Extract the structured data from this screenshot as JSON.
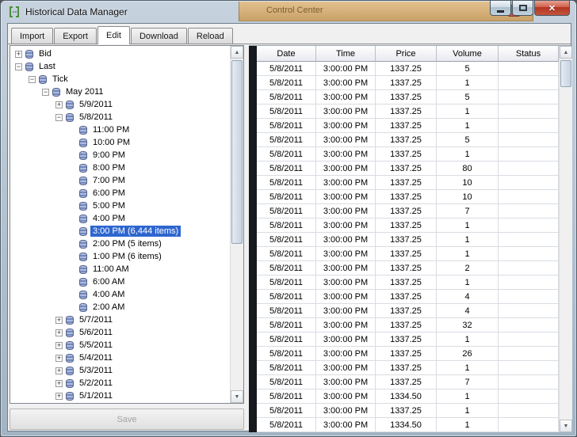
{
  "window": {
    "title": "Historical Data Manager"
  },
  "background_window": {
    "visible_text": "Control Center"
  },
  "icons": {
    "app": "bracket-icon",
    "minimize": "–",
    "maximize": "▢",
    "close": "✕",
    "scroll_up": "▲",
    "scroll_down": "▼",
    "tree_expand": "+",
    "tree_collapse": "−",
    "tree_node": "database-icon"
  },
  "colors": {
    "selection": "#2e66cf",
    "close_button": "#b23520",
    "background_window": "#d7a565",
    "client_background": "#f0f0f0",
    "row_header_strip": "#161a1f"
  },
  "tabs": [
    {
      "label": "Import",
      "active": false
    },
    {
      "label": "Export",
      "active": false
    },
    {
      "label": "Edit",
      "active": true
    },
    {
      "label": "Download",
      "active": false
    },
    {
      "label": "Reload",
      "active": false
    }
  ],
  "tree": {
    "items": [
      {
        "label": "Bid",
        "level": 0,
        "expand": "+"
      },
      {
        "label": "Last",
        "level": 0,
        "expand": "−"
      },
      {
        "label": "Tick",
        "level": 1,
        "expand": "−"
      },
      {
        "label": "May 2011",
        "level": 2,
        "expand": "−"
      },
      {
        "label": "5/9/2011",
        "level": 3,
        "expand": "+"
      },
      {
        "label": "5/8/2011",
        "level": 3,
        "expand": "−"
      },
      {
        "label": "11:00 PM",
        "level": 4
      },
      {
        "label": "10:00 PM",
        "level": 4
      },
      {
        "label": "9:00 PM",
        "level": 4
      },
      {
        "label": "8:00 PM",
        "level": 4
      },
      {
        "label": "7:00 PM",
        "level": 4
      },
      {
        "label": "6:00 PM",
        "level": 4
      },
      {
        "label": "5:00 PM",
        "level": 4
      },
      {
        "label": "4:00 PM",
        "level": 4
      },
      {
        "label": "3:00 PM (6,444 items)",
        "level": 4,
        "selected": true
      },
      {
        "label": "2:00 PM (5 items)",
        "level": 4
      },
      {
        "label": "1:00 PM (6 items)",
        "level": 4
      },
      {
        "label": "11:00 AM",
        "level": 4
      },
      {
        "label": "6:00 AM",
        "level": 4
      },
      {
        "label": "4:00 AM",
        "level": 4
      },
      {
        "label": "2:00 AM",
        "level": 4
      },
      {
        "label": "5/7/2011",
        "level": 3,
        "expand": "+"
      },
      {
        "label": "5/6/2011",
        "level": 3,
        "expand": "+"
      },
      {
        "label": "5/5/2011",
        "level": 3,
        "expand": "+"
      },
      {
        "label": "5/4/2011",
        "level": 3,
        "expand": "+"
      },
      {
        "label": "5/3/2011",
        "level": 3,
        "expand": "+"
      },
      {
        "label": "5/2/2011",
        "level": 3,
        "expand": "+"
      },
      {
        "label": "5/1/2011",
        "level": 3,
        "expand": "+"
      }
    ]
  },
  "buttons": {
    "save": {
      "label": "Save",
      "enabled": false
    }
  },
  "grid": {
    "columns": [
      "Date",
      "Time",
      "Price",
      "Volume",
      "Status"
    ],
    "rows": [
      [
        "5/8/2011",
        "3:00:00 PM",
        "1337.25",
        "5",
        ""
      ],
      [
        "5/8/2011",
        "3:00:00 PM",
        "1337.25",
        "1",
        ""
      ],
      [
        "5/8/2011",
        "3:00:00 PM",
        "1337.25",
        "5",
        ""
      ],
      [
        "5/8/2011",
        "3:00:00 PM",
        "1337.25",
        "1",
        ""
      ],
      [
        "5/8/2011",
        "3:00:00 PM",
        "1337.25",
        "1",
        ""
      ],
      [
        "5/8/2011",
        "3:00:00 PM",
        "1337.25",
        "5",
        ""
      ],
      [
        "5/8/2011",
        "3:00:00 PM",
        "1337.25",
        "1",
        ""
      ],
      [
        "5/8/2011",
        "3:00:00 PM",
        "1337.25",
        "80",
        ""
      ],
      [
        "5/8/2011",
        "3:00:00 PM",
        "1337.25",
        "10",
        ""
      ],
      [
        "5/8/2011",
        "3:00:00 PM",
        "1337.25",
        "10",
        ""
      ],
      [
        "5/8/2011",
        "3:00:00 PM",
        "1337.25",
        "7",
        ""
      ],
      [
        "5/8/2011",
        "3:00:00 PM",
        "1337.25",
        "1",
        ""
      ],
      [
        "5/8/2011",
        "3:00:00 PM",
        "1337.25",
        "1",
        ""
      ],
      [
        "5/8/2011",
        "3:00:00 PM",
        "1337.25",
        "1",
        ""
      ],
      [
        "5/8/2011",
        "3:00:00 PM",
        "1337.25",
        "2",
        ""
      ],
      [
        "5/8/2011",
        "3:00:00 PM",
        "1337.25",
        "1",
        ""
      ],
      [
        "5/8/2011",
        "3:00:00 PM",
        "1337.25",
        "4",
        ""
      ],
      [
        "5/8/2011",
        "3:00:00 PM",
        "1337.25",
        "4",
        ""
      ],
      [
        "5/8/2011",
        "3:00:00 PM",
        "1337.25",
        "32",
        ""
      ],
      [
        "5/8/2011",
        "3:00:00 PM",
        "1337.25",
        "1",
        ""
      ],
      [
        "5/8/2011",
        "3:00:00 PM",
        "1337.25",
        "26",
        ""
      ],
      [
        "5/8/2011",
        "3:00:00 PM",
        "1337.25",
        "1",
        ""
      ],
      [
        "5/8/2011",
        "3:00:00 PM",
        "1337.25",
        "7",
        ""
      ],
      [
        "5/8/2011",
        "3:00:00 PM",
        "1334.50",
        "1",
        ""
      ],
      [
        "5/8/2011",
        "3:00:00 PM",
        "1337.25",
        "1",
        ""
      ],
      [
        "5/8/2011",
        "3:00:00 PM",
        "1334.50",
        "1",
        ""
      ]
    ]
  }
}
